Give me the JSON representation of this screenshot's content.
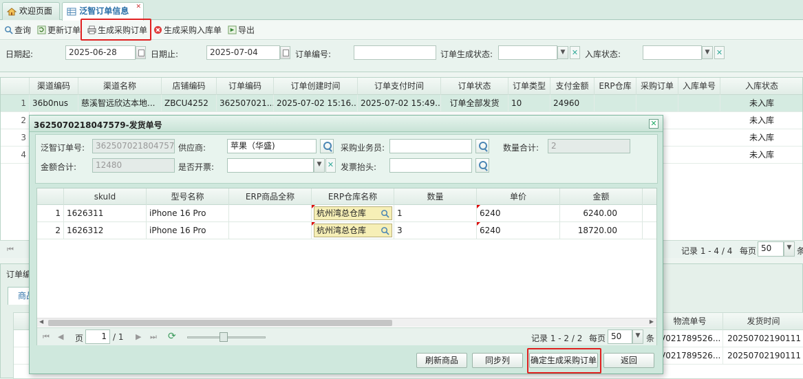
{
  "tabs": [
    {
      "label": "欢迎页面",
      "icon": "home-icon"
    },
    {
      "label": "泛智订单信息",
      "icon": "grid-icon"
    }
  ],
  "toolbar": {
    "query": "查询",
    "update": "更新订单",
    "generate_po": "生成采购订单",
    "generate_receipt": "生成采购入库单",
    "export": "导出"
  },
  "filters": {
    "date_from_label": "日期起:",
    "date_from": "2025-06-28",
    "date_to_label": "日期止:",
    "date_to": "2025-07-04",
    "order_no_label": "订单编号:",
    "order_no": "",
    "gen_status_label": "订单生成状态:",
    "gen_status": "",
    "in_status_label": "入库状态:",
    "in_status": ""
  },
  "main_grid": {
    "columns": [
      "渠道编码",
      "渠道名称",
      "店铺编码",
      "订单编码",
      "订单创建时间",
      "订单支付时间",
      "订单状态",
      "订单类型",
      "支付金额",
      "ERP仓库",
      "采购订单",
      "入库单号",
      "入库状态"
    ],
    "rows": [
      {
        "n": "1",
        "channel_code": "36b0nus",
        "channel_name": "慈溪智远欣达本地...",
        "shop_code": "ZBCU4252",
        "order_code": "362507021...",
        "created": "2025-07-02 15:16...",
        "paid": "2025-07-02 15:49...",
        "status": "订单全部发货",
        "type": "10",
        "amount": "24960",
        "erp_wh": "",
        "po": "",
        "receipt": "",
        "in_status": "未入库"
      },
      {
        "n": "2",
        "in_status": "未入库"
      },
      {
        "n": "3",
        "in_status": "未入库"
      },
      {
        "n": "4",
        "in_status": "未入库"
      }
    ]
  },
  "main_pager": {
    "records": "记录 1 - 4 / 4",
    "per_page_label": "每页",
    "per_page": "50",
    "suffix": "条"
  },
  "lower_panel": {
    "title": "订单编",
    "tab": "商品",
    "columns": [
      "物流单号",
      "发货时间"
    ],
    "rows": [
      {
        "tracking": "V021789526...",
        "ship_time": "20250702190111"
      },
      {
        "tracking": "V021789526...",
        "ship_time": "20250702190111"
      }
    ]
  },
  "dialog": {
    "title": "3625070218047579-发货单号",
    "order_no_label": "泛智订单号:",
    "order_no": "3625070218047579",
    "supplier_label": "供应商:",
    "supplier": "苹果（华盛)",
    "buyer_label": "采购业务员:",
    "buyer": "",
    "qty_total_label": "数量合计:",
    "qty_total": "2",
    "amount_total_label": "金额合计:",
    "amount_total": "12480",
    "invoice_label": "是否开票:",
    "invoice": "",
    "invoice_title_label": "发票抬头:",
    "invoice_title": "",
    "columns": [
      "skuId",
      "型号名称",
      "ERP商品全称",
      "ERP仓库名称",
      "数量",
      "单价",
      "金额"
    ],
    "rows": [
      {
        "n": "1",
        "sku": "1626311",
        "model": "iPhone 16 Pro",
        "erp_name": "",
        "warehouse": "杭州湾总仓库",
        "qty": "1",
        "price": "6240",
        "amount": "6240.00"
      },
      {
        "n": "2",
        "sku": "1626312",
        "model": "iPhone 16 Pro",
        "erp_name": "",
        "warehouse": "杭州湾总仓库",
        "qty": "3",
        "price": "6240",
        "amount": "18720.00"
      }
    ],
    "pager": {
      "page_label": "页",
      "page": "1",
      "total": "/ 1",
      "records": "记录 1 - 2 / 2",
      "per_page_label": "每页",
      "per_page": "50",
      "suffix": "条"
    },
    "buttons": {
      "refresh": "刷新商品",
      "sync": "同步列",
      "confirm": "确定生成采购订单",
      "back": "返回"
    }
  },
  "colors": {
    "accent_blue": "#2a6fa8",
    "highlight_red": "#e02020",
    "warehouse_yellow": "#f6efb6"
  }
}
